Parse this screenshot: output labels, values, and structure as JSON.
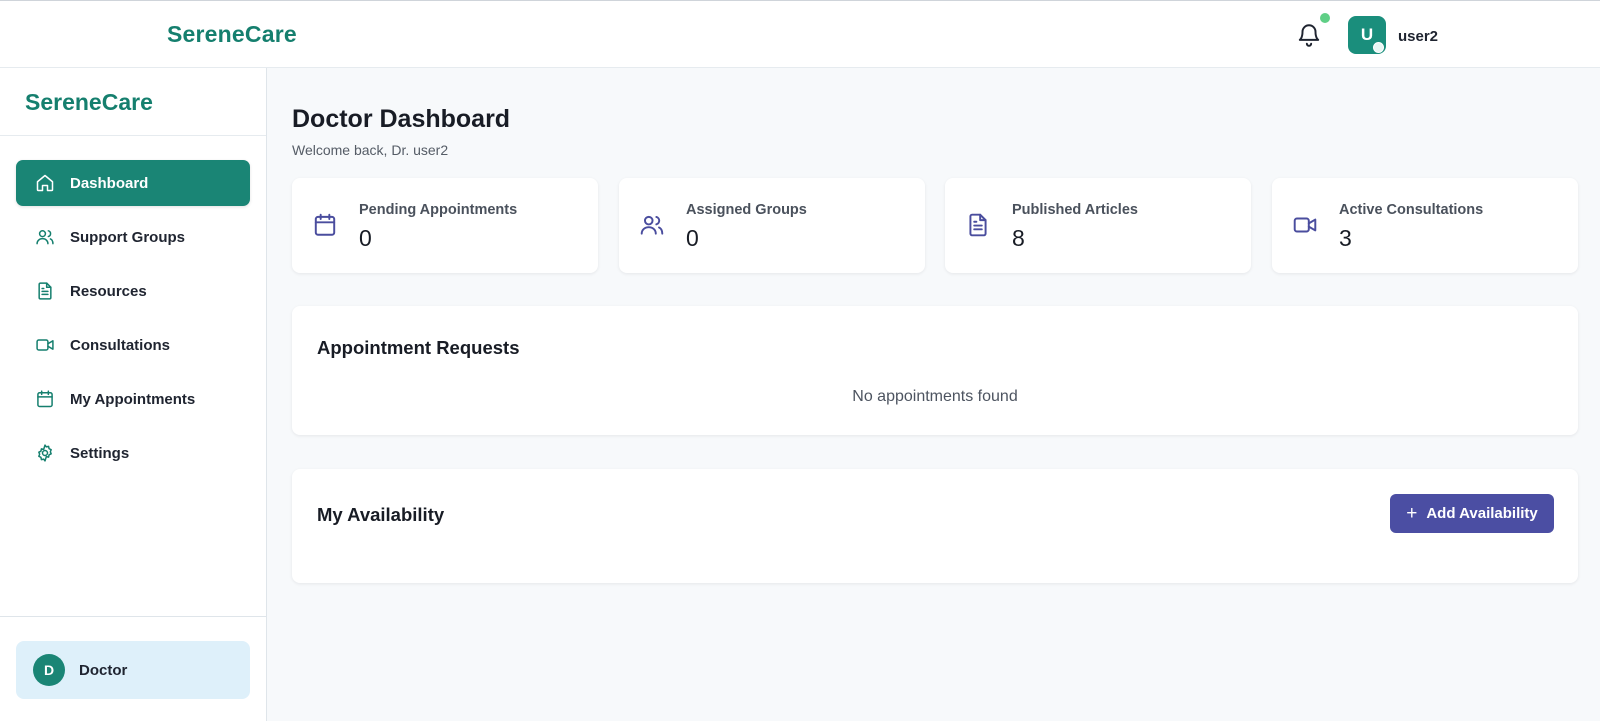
{
  "brand": {
    "name": "SereneCare"
  },
  "header": {
    "username": "user2",
    "avatar_initial": "U"
  },
  "colors": {
    "brand": "#157f6e",
    "active_nav": "#1a8575",
    "accent": "#4b4ea3",
    "stat_icon": "#4a4d9e"
  },
  "sidebar": {
    "items": [
      {
        "label": "Dashboard",
        "icon": "home-icon",
        "active": true
      },
      {
        "label": "Support Groups",
        "icon": "users-icon"
      },
      {
        "label": "Resources",
        "icon": "document-icon"
      },
      {
        "label": "Consultations",
        "icon": "video-icon"
      },
      {
        "label": "My Appointments",
        "icon": "calendar-icon"
      },
      {
        "label": "Settings",
        "icon": "gear-icon"
      }
    ],
    "user": {
      "initial": "D",
      "role": "Doctor"
    }
  },
  "main": {
    "title": "Doctor Dashboard",
    "subtitle": "Welcome back, Dr. user2",
    "stats": [
      {
        "label": "Pending Appointments",
        "value": "0",
        "icon": "calendar-icon"
      },
      {
        "label": "Assigned Groups",
        "value": "0",
        "icon": "users-icon"
      },
      {
        "label": "Published Articles",
        "value": "8",
        "icon": "document-icon"
      },
      {
        "label": "Active Consultations",
        "value": "3",
        "icon": "video-icon"
      }
    ],
    "appointments": {
      "title": "Appointment Requests",
      "empty_text": "No appointments found"
    },
    "availability": {
      "title": "My Availability",
      "button_label": "Add Availability"
    }
  }
}
